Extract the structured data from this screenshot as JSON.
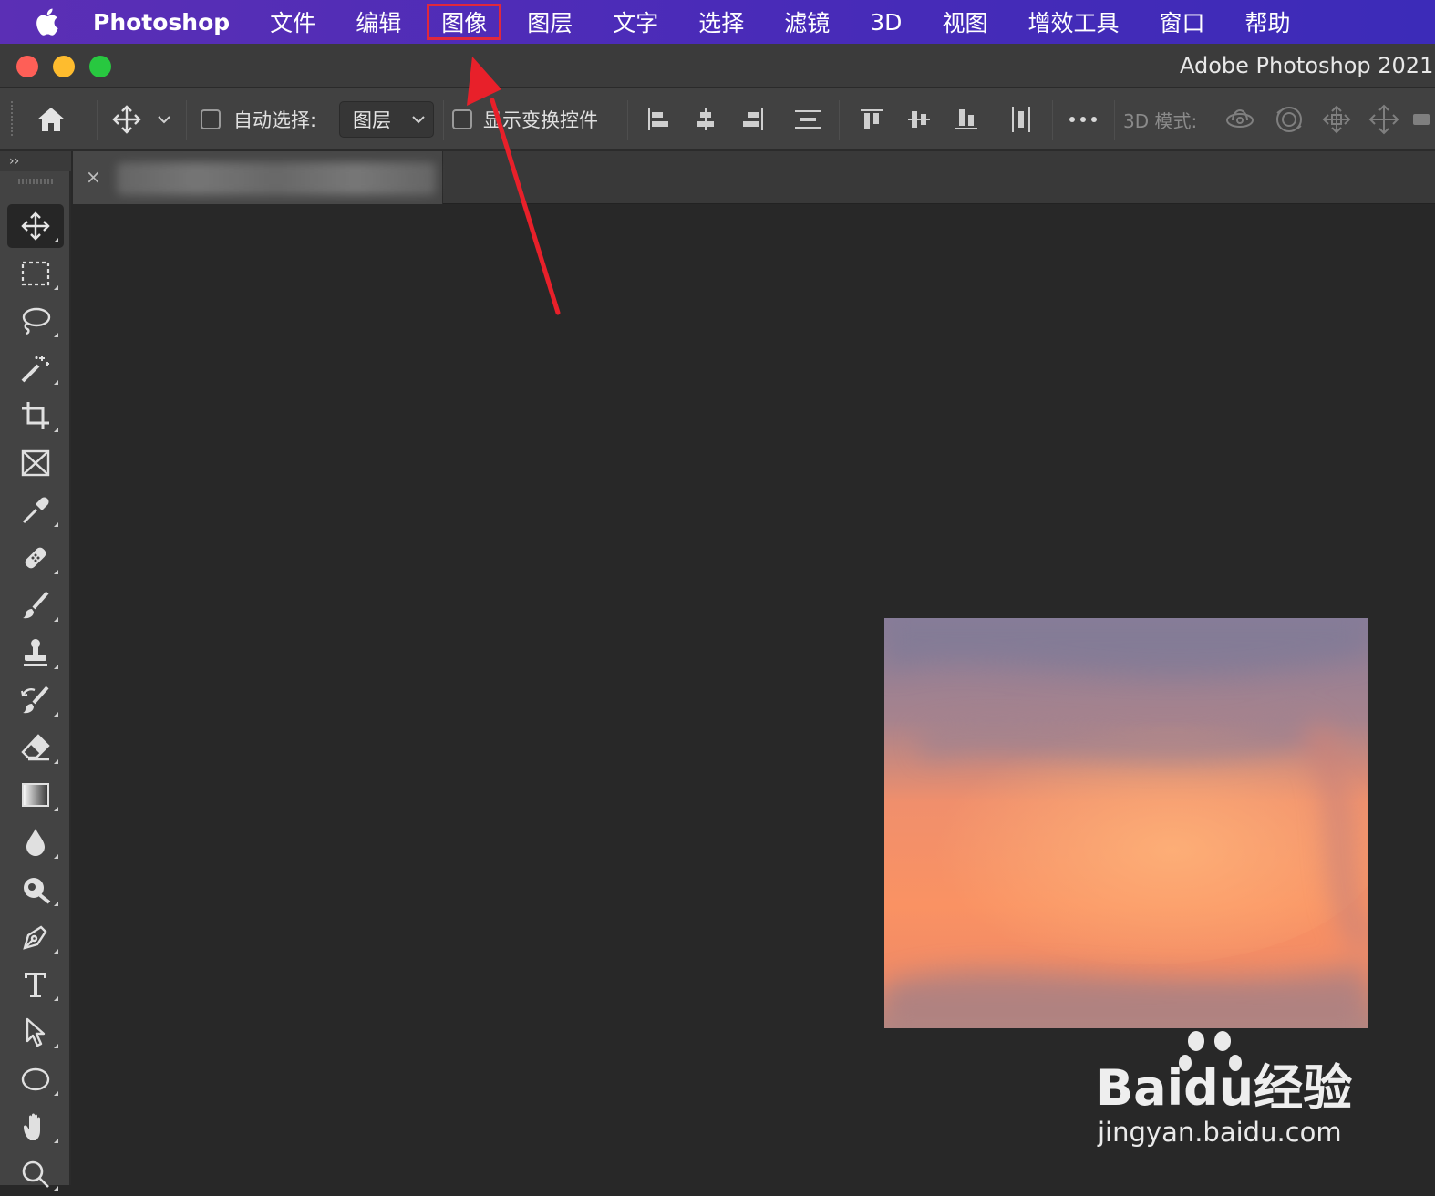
{
  "menubar": {
    "app_name": "Photoshop",
    "items": [
      "文件",
      "编辑",
      "图像",
      "图层",
      "文字",
      "选择",
      "滤镜",
      "3D",
      "视图",
      "增效工具",
      "窗口",
      "帮助"
    ],
    "highlighted_item": "图像",
    "highlight_color": "#e0283c"
  },
  "window": {
    "title": "Adobe Photoshop 2021"
  },
  "options_bar": {
    "auto_select_label": "自动选择:",
    "auto_select_value": "图层",
    "show_transform_label": "显示变换控件",
    "mode_3d_label": "3D 模式:"
  },
  "toolbar": {
    "collapse_glyph": "››",
    "tools": [
      "move-tool",
      "marquee-tool",
      "lasso-tool",
      "magic-wand-tool",
      "crop-tool",
      "frame-tool",
      "eyedropper-tool",
      "healing-brush-tool",
      "brush-tool",
      "clone-stamp-tool",
      "history-brush-tool",
      "eraser-tool",
      "gradient-tool",
      "blur-tool",
      "dodge-tool",
      "pen-tool",
      "type-tool",
      "path-selection-tool",
      "ellipse-tool",
      "hand-tool",
      "zoom-tool"
    ],
    "active_tool": "move-tool"
  },
  "document_tab": {
    "close_glyph": "×"
  },
  "watermark": {
    "brand_text": "Baidu经验",
    "url_text": "jingyan.baidu.com"
  },
  "annotation": {
    "arrow_color": "#e8202a"
  }
}
